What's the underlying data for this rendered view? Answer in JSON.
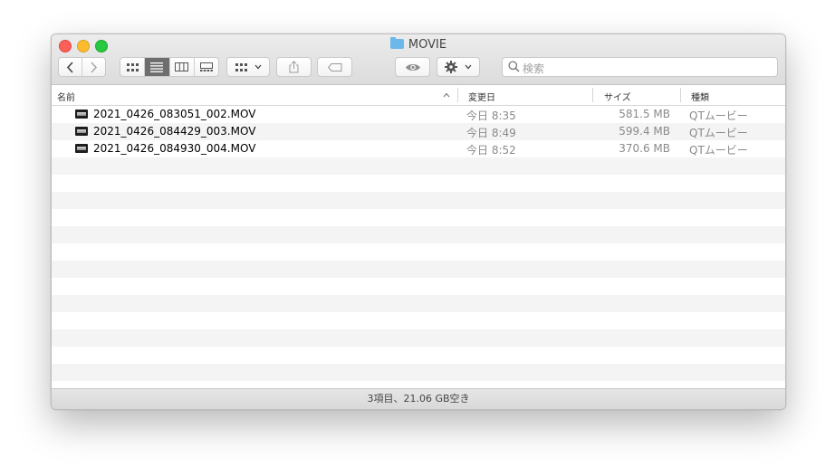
{
  "window": {
    "title": "MOVIE",
    "folder_color": "#6cb8ea"
  },
  "toolbar": {
    "back_icon": "chevron-left-icon",
    "forward_icon": "chevron-right-icon",
    "view_modes": [
      "icon-view",
      "list-view",
      "column-view",
      "gallery-view"
    ],
    "active_view": "list-view",
    "search_placeholder": "検索"
  },
  "columns": {
    "name": "名前",
    "date": "変更日",
    "size": "サイズ",
    "kind": "種類"
  },
  "files": [
    {
      "name": "2021_0426_083051_002.MOV",
      "date": "今日 8:35",
      "size": "581.5 MB",
      "kind": "QTムービー"
    },
    {
      "name": "2021_0426_084429_003.MOV",
      "date": "今日 8:49",
      "size": "599.4 MB",
      "kind": "QTムービー"
    },
    {
      "name": "2021_0426_084930_004.MOV",
      "date": "今日 8:52",
      "size": "370.6 MB",
      "kind": "QTムービー"
    }
  ],
  "status": "3項目、21.06 GB空き",
  "colors": {
    "close": "#fc5f57",
    "minimize": "#fdbc2e",
    "maximize": "#28c840",
    "stripe": "#f4f4f4"
  }
}
